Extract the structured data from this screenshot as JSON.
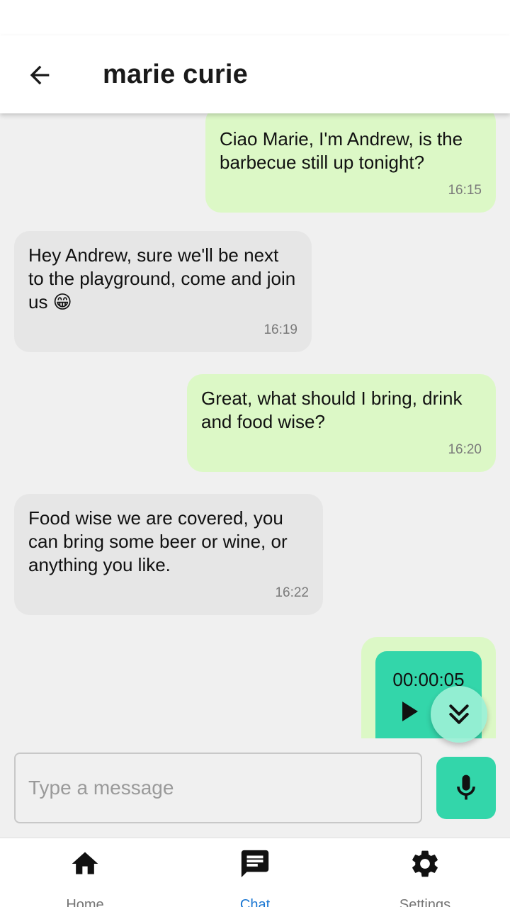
{
  "header": {
    "title": "marie curie",
    "back_icon": "arrow-left-icon"
  },
  "messages": [
    {
      "direction": "sent",
      "text": "Ciao Marie, I'm Andrew, is the barbecue still up tonight?",
      "time": "16:15"
    },
    {
      "direction": "received",
      "text": "Hey Andrew, sure we'll be next to the playground, come and join us 😁",
      "time": "16:19"
    },
    {
      "direction": "sent",
      "text": "Great, what should I bring, drink and food wise?",
      "time": "16:20"
    },
    {
      "direction": "received",
      "text": "Food wise we are covered, you can bring some beer or wine, or anything you like.",
      "time": "16:22"
    },
    {
      "direction": "sent",
      "type": "voice",
      "duration": "00:00:05",
      "icon": "play-icon"
    }
  ],
  "scroll_button": {
    "icon": "double-chevron-down-icon"
  },
  "composer": {
    "placeholder": "Type a message",
    "value": "",
    "mic_icon": "microphone-icon"
  },
  "nav": {
    "items": [
      {
        "label": "Home",
        "icon": "home-icon",
        "active": false
      },
      {
        "label": "Chat",
        "icon": "chat-icon",
        "active": true
      },
      {
        "label": "Settings",
        "icon": "gear-icon",
        "active": false
      }
    ]
  },
  "colors": {
    "accent": "#33d6aa",
    "sent_bubble": "#dcf8c6",
    "received_bubble": "#e6e6e6",
    "nav_active": "#1976d2",
    "background": "#f0f0f0"
  }
}
